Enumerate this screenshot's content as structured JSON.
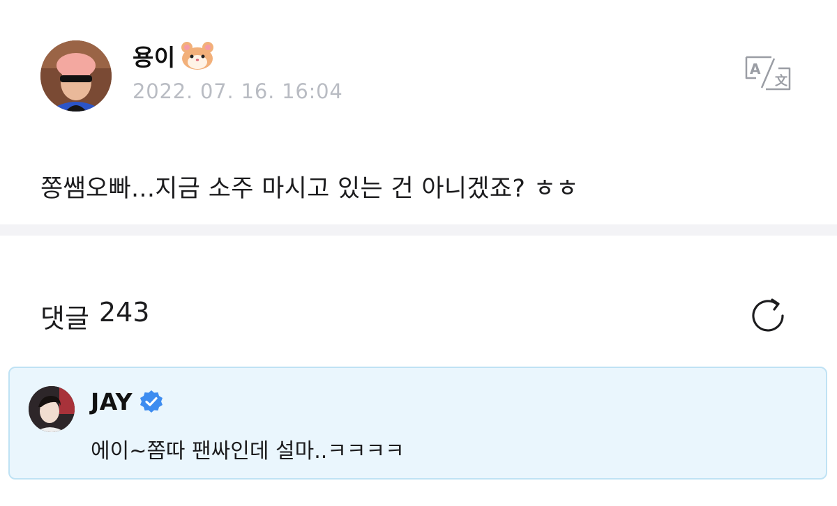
{
  "post": {
    "author": "용이",
    "author_emoji": "hamster-face-icon",
    "timestamp": "2022. 07. 16. 16:04",
    "body": "쫑쌤오빠...지금 소주 마시고 있는 건 아니겠죠? ㅎㅎ",
    "translate_icon": "translate-icon"
  },
  "comments": {
    "label": "댓글",
    "count": "243",
    "refresh_icon": "refresh-icon"
  },
  "highlighted_comment": {
    "author": "JAY",
    "verified_icon": "verified-badge-icon",
    "body": "에이~쫌따 팬싸인데 설마..ㅋㅋㅋㅋ"
  },
  "colors": {
    "timestamp": "#b9bcc3",
    "divider": "#f3f3f6",
    "comment_bg": "#eaf6fd",
    "comment_border": "#bfe2f4",
    "verified": "#3d8cf0"
  }
}
